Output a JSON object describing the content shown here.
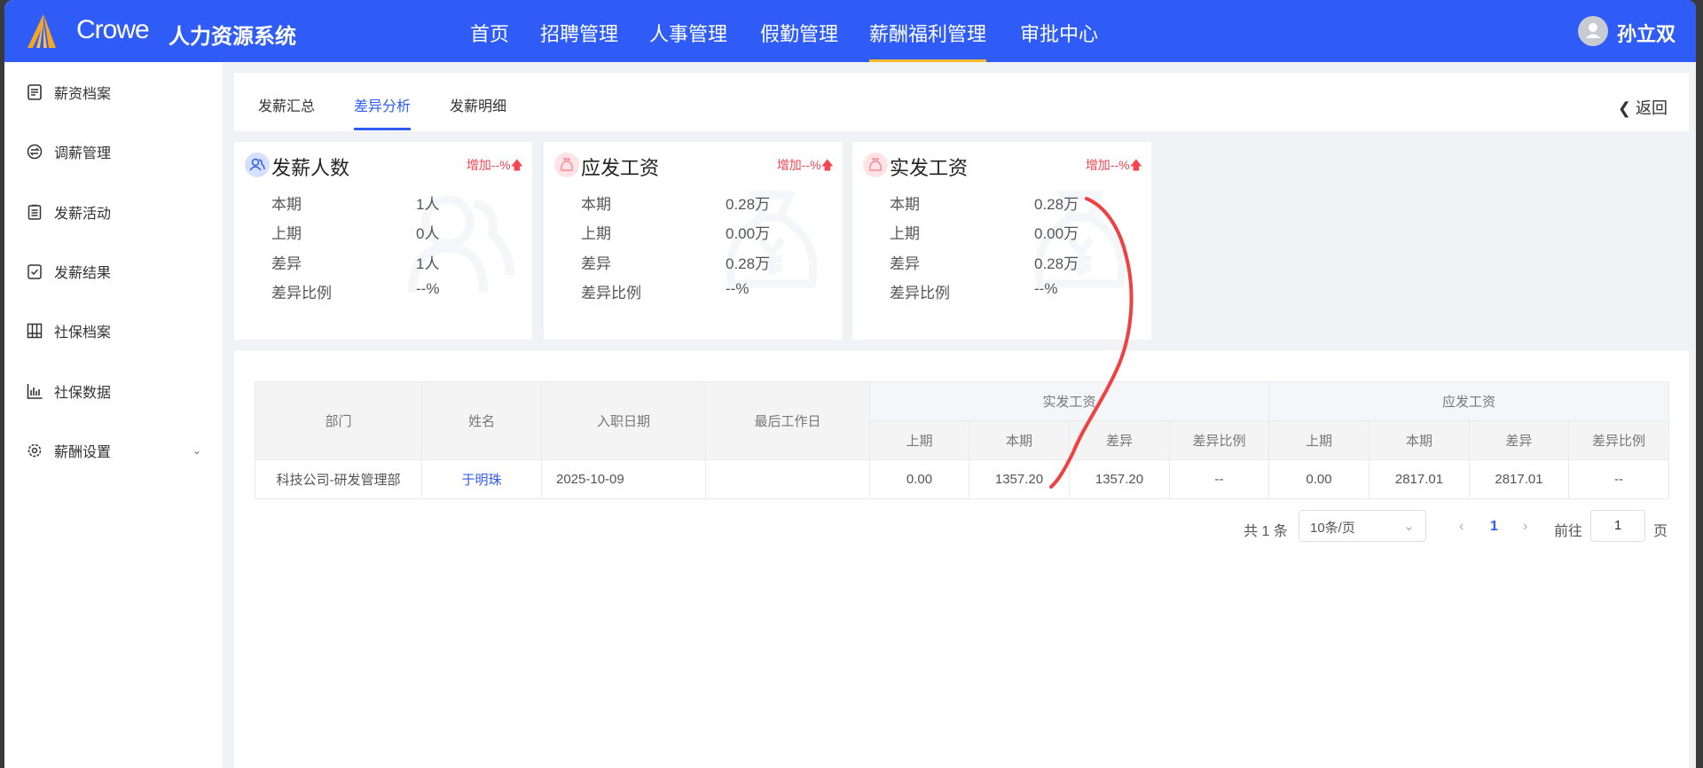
{
  "header": {
    "brand": "Crowe",
    "system": "人力资源系统",
    "nav": [
      "首页",
      "招聘管理",
      "人事管理",
      "假勤管理",
      "薪酬福利管理",
      "审批中心"
    ],
    "active_nav": "薪酬福利管理",
    "user": "孙立双"
  },
  "sidebar": {
    "items": [
      {
        "label": "薪资档案",
        "icon": "document-icon"
      },
      {
        "label": "调薪管理",
        "icon": "exchange-icon"
      },
      {
        "label": "发薪活动",
        "icon": "clipboard-icon"
      },
      {
        "label": "发薪结果",
        "icon": "clipboard-check-icon"
      },
      {
        "label": "社保档案",
        "icon": "archive-icon"
      },
      {
        "label": "社保数据",
        "icon": "bar-chart-icon"
      },
      {
        "label": "薪酬设置",
        "icon": "gear-icon"
      }
    ]
  },
  "tabs": {
    "items": [
      "发薪汇总",
      "差异分析",
      "发薪明细"
    ],
    "active": "差异分析",
    "back": "返回"
  },
  "stats": [
    {
      "title": "发薪人数",
      "trend": "增加--%",
      "rows": [
        {
          "label": "本期",
          "value": "1人"
        },
        {
          "label": "上期",
          "value": "0人"
        },
        {
          "label": "差异",
          "value": "1人"
        },
        {
          "label": "差异比例",
          "value": "--%"
        }
      ]
    },
    {
      "title": "应发工资",
      "trend": "增加--%",
      "rows": [
        {
          "label": "本期",
          "value": "0.28万"
        },
        {
          "label": "上期",
          "value": "0.00万"
        },
        {
          "label": "差异",
          "value": "0.28万"
        },
        {
          "label": "差异比例",
          "value": "--%"
        }
      ]
    },
    {
      "title": "实发工资",
      "trend": "增加--%",
      "rows": [
        {
          "label": "本期",
          "value": "0.28万"
        },
        {
          "label": "上期",
          "value": "0.00万"
        },
        {
          "label": "差异",
          "value": "0.28万"
        },
        {
          "label": "差异比例",
          "value": "--%"
        }
      ]
    }
  ],
  "table": {
    "headers": {
      "dept": "部门",
      "name": "姓名",
      "hire": "入职日期",
      "last": "最后工作日",
      "group1": "实发工资",
      "group2": "应发工资",
      "sub": [
        "上期",
        "本期",
        "差异",
        "差异比例"
      ]
    },
    "rows": [
      {
        "dept": "科技公司-研发管理部",
        "name": "于明珠",
        "hire": "2025-10-09",
        "last": "",
        "actual": [
          "0.00",
          "1357.20",
          "1357.20",
          "--"
        ],
        "due": [
          "0.00",
          "2817.01",
          "2817.01",
          "--"
        ]
      }
    ]
  },
  "pagination": {
    "total": "共 1 条",
    "page_size": "10条/页",
    "current": "1",
    "goto": "前往",
    "goto_value": "1",
    "page_unit": "页"
  },
  "colors": {
    "primary": "#2f5cf6",
    "accent": "#f5b92e",
    "danger": "#f5454f"
  }
}
